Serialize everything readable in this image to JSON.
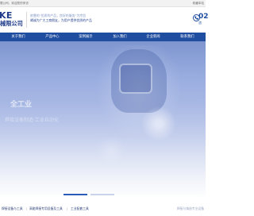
{
  "topbar": {
    "welcome": "限公司，欢迎您的来访",
    "favorite": "收藏本站"
  },
  "header": {
    "brand": "KE",
    "company": "械限公司",
    "slogan_line1": "依靠的“优质的产品，良好的服务”为宗旨",
    "slogan_line2": "竭诚为广大工商朋友，为用户提供优质的产品",
    "hotline_number": "02",
    "hotline_sub": "咨"
  },
  "nav": {
    "items": [
      "关于我们",
      "产品中心",
      "案例展示",
      "加入我们",
      "企业新闻",
      "联系我们"
    ]
  },
  "banner": {
    "caption1": "全工业",
    "caption2": "焊接设备制造·工业自动化"
  },
  "footer": {
    "links": [
      "焊接设备与工具",
      "高能焊接专用设备及工具",
      "工业配套工具"
    ],
    "more": "焊接与铸造专业设备"
  }
}
